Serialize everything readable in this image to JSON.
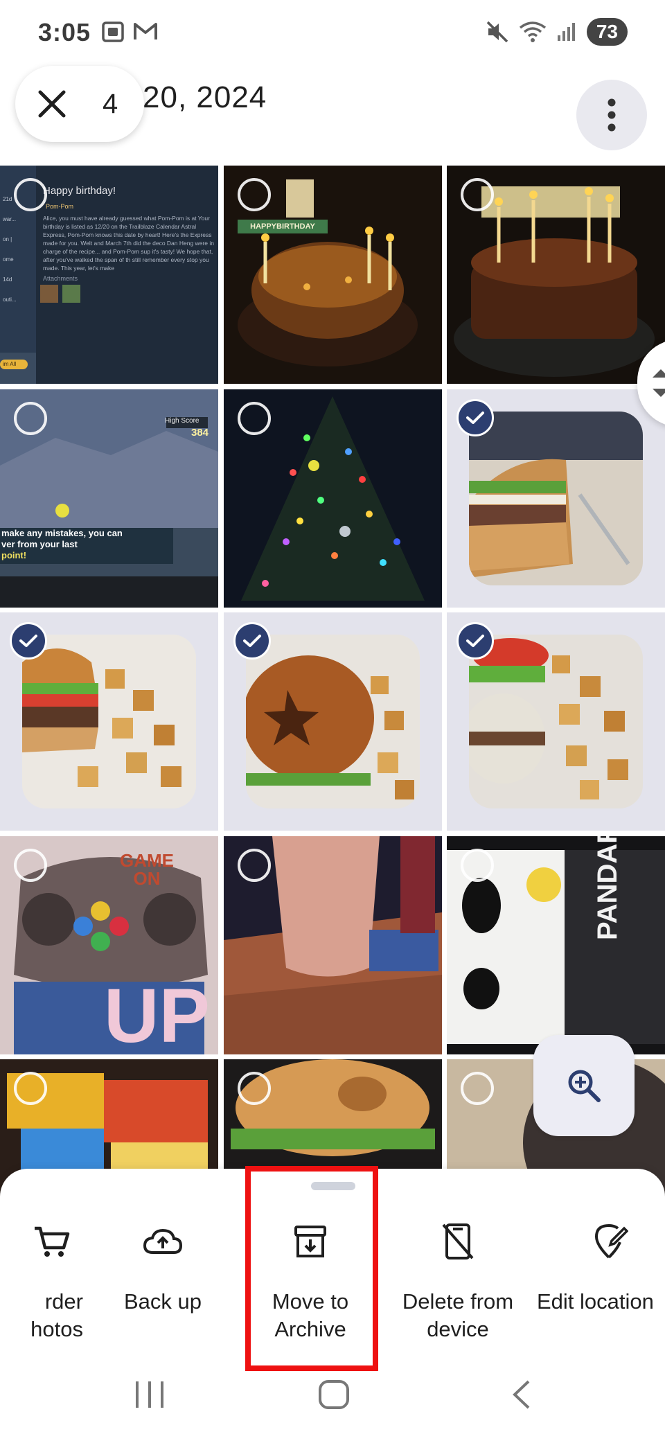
{
  "status_bar": {
    "time": "3:05",
    "battery": "73",
    "left_icons": [
      "screenshot-icon",
      "gmail-icon"
    ],
    "right_icons": [
      "mute-icon",
      "wifi-icon",
      "signal-icon"
    ]
  },
  "header": {
    "selection_count": "4",
    "date": "20, 2024"
  },
  "grid": {
    "photos": [
      {
        "subject": "game screenshot - happy birthday message",
        "selected": false,
        "overlay_title": "Happy birthday!",
        "overlay_sender": "Pom-Pom",
        "overlay_body": "Alice, you must have already guessed what Pom-Pom is at Your birthday is listed as 12/20 on the Trailblaze Calendar Astral Express, Pom-Pom knows this date by heart! Here's the Express made for you. Welt and March 7th did the deco Dan Heng were in charge of the recipe... and Pom-Pom sup it's tasty! We hope that, after you've walked the span of th still remember every stop you made. This year, let's make",
        "overlay_attachments": "Attachments",
        "overlay_button": "im All",
        "overlay_side": [
          "21d",
          "war...",
          "on |",
          "ome",
          "14d",
          "outi..."
        ]
      },
      {
        "subject": "birthday cake with candles",
        "selected": false,
        "cake_topper": "HAPPYBIRTHDAY"
      },
      {
        "subject": "chocolate cake with lit candles",
        "selected": false
      },
      {
        "subject": "game screenshot on tv",
        "selected": false,
        "hud_label": "High Score",
        "hud_value": "384",
        "hint_line1": "make any mistakes, you can",
        "hint_line2": "ver from your last",
        "hint_line3": "point!"
      },
      {
        "subject": "christmas tree with lights",
        "selected": false
      },
      {
        "subject": "burger on plate",
        "selected": true
      },
      {
        "subject": "burger and potatoes",
        "selected": true
      },
      {
        "subject": "bun with star and fries",
        "selected": true
      },
      {
        "subject": "burger with tomato and potatoes",
        "selected": true
      },
      {
        "subject": "game on controller blanket",
        "selected": false,
        "blanket_text_top": "GAME ON",
        "blanket_text_bottom": "UP"
      },
      {
        "subject": "drink on wooden table",
        "selected": false
      },
      {
        "subject": "panda snack bag",
        "selected": false,
        "bag_text": "PANDAROO"
      },
      {
        "subject": "snack packages",
        "selected": false
      },
      {
        "subject": "bagel sandwich",
        "selected": false
      },
      {
        "subject": "dark bowl",
        "selected": false
      }
    ]
  },
  "actions": [
    {
      "label": "rder\nhotos",
      "icon": "cart-icon"
    },
    {
      "label": "Back up",
      "icon": "cloud-upload-icon"
    },
    {
      "label": "Move to\nArchive",
      "icon": "archive-icon"
    },
    {
      "label": "Delete from\ndevice",
      "icon": "delete-device-icon"
    },
    {
      "label": "Edit location",
      "icon": "edit-location-icon"
    }
  ],
  "colors": {
    "accent": "#2c3e70",
    "selected_bg": "#e3e3ec",
    "highlight": "#ee1111"
  }
}
